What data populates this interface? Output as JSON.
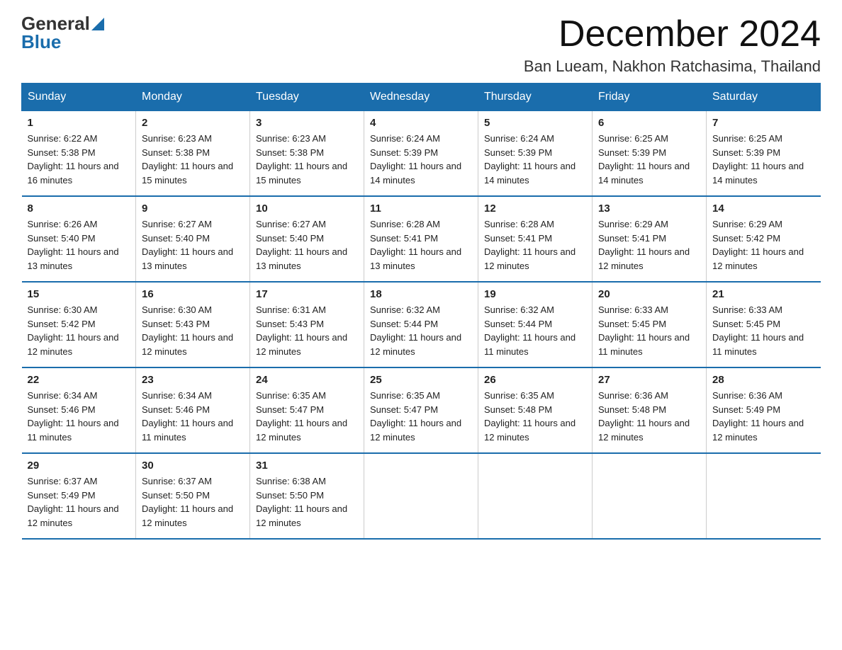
{
  "logo": {
    "general": "General",
    "blue": "Blue"
  },
  "title": {
    "month_year": "December 2024",
    "location": "Ban Lueam, Nakhon Ratchasima, Thailand"
  },
  "days_of_week": [
    "Sunday",
    "Monday",
    "Tuesday",
    "Wednesday",
    "Thursday",
    "Friday",
    "Saturday"
  ],
  "weeks": [
    [
      {
        "day": "1",
        "sunrise": "6:22 AM",
        "sunset": "5:38 PM",
        "daylight": "11 hours and 16 minutes."
      },
      {
        "day": "2",
        "sunrise": "6:23 AM",
        "sunset": "5:38 PM",
        "daylight": "11 hours and 15 minutes."
      },
      {
        "day": "3",
        "sunrise": "6:23 AM",
        "sunset": "5:38 PM",
        "daylight": "11 hours and 15 minutes."
      },
      {
        "day": "4",
        "sunrise": "6:24 AM",
        "sunset": "5:39 PM",
        "daylight": "11 hours and 14 minutes."
      },
      {
        "day": "5",
        "sunrise": "6:24 AM",
        "sunset": "5:39 PM",
        "daylight": "11 hours and 14 minutes."
      },
      {
        "day": "6",
        "sunrise": "6:25 AM",
        "sunset": "5:39 PM",
        "daylight": "11 hours and 14 minutes."
      },
      {
        "day": "7",
        "sunrise": "6:25 AM",
        "sunset": "5:39 PM",
        "daylight": "11 hours and 14 minutes."
      }
    ],
    [
      {
        "day": "8",
        "sunrise": "6:26 AM",
        "sunset": "5:40 PM",
        "daylight": "11 hours and 13 minutes."
      },
      {
        "day": "9",
        "sunrise": "6:27 AM",
        "sunset": "5:40 PM",
        "daylight": "11 hours and 13 minutes."
      },
      {
        "day": "10",
        "sunrise": "6:27 AM",
        "sunset": "5:40 PM",
        "daylight": "11 hours and 13 minutes."
      },
      {
        "day": "11",
        "sunrise": "6:28 AM",
        "sunset": "5:41 PM",
        "daylight": "11 hours and 13 minutes."
      },
      {
        "day": "12",
        "sunrise": "6:28 AM",
        "sunset": "5:41 PM",
        "daylight": "11 hours and 12 minutes."
      },
      {
        "day": "13",
        "sunrise": "6:29 AM",
        "sunset": "5:41 PM",
        "daylight": "11 hours and 12 minutes."
      },
      {
        "day": "14",
        "sunrise": "6:29 AM",
        "sunset": "5:42 PM",
        "daylight": "11 hours and 12 minutes."
      }
    ],
    [
      {
        "day": "15",
        "sunrise": "6:30 AM",
        "sunset": "5:42 PM",
        "daylight": "11 hours and 12 minutes."
      },
      {
        "day": "16",
        "sunrise": "6:30 AM",
        "sunset": "5:43 PM",
        "daylight": "11 hours and 12 minutes."
      },
      {
        "day": "17",
        "sunrise": "6:31 AM",
        "sunset": "5:43 PM",
        "daylight": "11 hours and 12 minutes."
      },
      {
        "day": "18",
        "sunrise": "6:32 AM",
        "sunset": "5:44 PM",
        "daylight": "11 hours and 12 minutes."
      },
      {
        "day": "19",
        "sunrise": "6:32 AM",
        "sunset": "5:44 PM",
        "daylight": "11 hours and 11 minutes."
      },
      {
        "day": "20",
        "sunrise": "6:33 AM",
        "sunset": "5:45 PM",
        "daylight": "11 hours and 11 minutes."
      },
      {
        "day": "21",
        "sunrise": "6:33 AM",
        "sunset": "5:45 PM",
        "daylight": "11 hours and 11 minutes."
      }
    ],
    [
      {
        "day": "22",
        "sunrise": "6:34 AM",
        "sunset": "5:46 PM",
        "daylight": "11 hours and 11 minutes."
      },
      {
        "day": "23",
        "sunrise": "6:34 AM",
        "sunset": "5:46 PM",
        "daylight": "11 hours and 11 minutes."
      },
      {
        "day": "24",
        "sunrise": "6:35 AM",
        "sunset": "5:47 PM",
        "daylight": "11 hours and 12 minutes."
      },
      {
        "day": "25",
        "sunrise": "6:35 AM",
        "sunset": "5:47 PM",
        "daylight": "11 hours and 12 minutes."
      },
      {
        "day": "26",
        "sunrise": "6:35 AM",
        "sunset": "5:48 PM",
        "daylight": "11 hours and 12 minutes."
      },
      {
        "day": "27",
        "sunrise": "6:36 AM",
        "sunset": "5:48 PM",
        "daylight": "11 hours and 12 minutes."
      },
      {
        "day": "28",
        "sunrise": "6:36 AM",
        "sunset": "5:49 PM",
        "daylight": "11 hours and 12 minutes."
      }
    ],
    [
      {
        "day": "29",
        "sunrise": "6:37 AM",
        "sunset": "5:49 PM",
        "daylight": "11 hours and 12 minutes."
      },
      {
        "day": "30",
        "sunrise": "6:37 AM",
        "sunset": "5:50 PM",
        "daylight": "11 hours and 12 minutes."
      },
      {
        "day": "31",
        "sunrise": "6:38 AM",
        "sunset": "5:50 PM",
        "daylight": "11 hours and 12 minutes."
      },
      null,
      null,
      null,
      null
    ]
  ]
}
